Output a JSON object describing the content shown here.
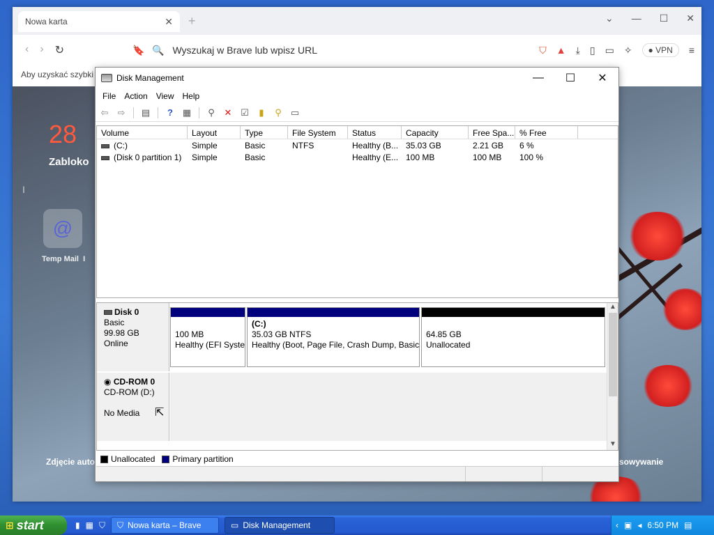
{
  "browser": {
    "tab_title": "Nowa karta",
    "tab_close": "✕",
    "new_tab": "+",
    "omnibox_placeholder": "Wyszukaj w Brave lub wpisz URL",
    "vpn_label": "VPN",
    "infobar_text": "Aby uzyskać szybki d",
    "newtab_page": {
      "date_number": "28",
      "status_text": "Zabloko",
      "tile_label": "Temp Mail",
      "tile_label_suffix": "I",
      "photo_text": "Zdjęcie auto",
      "sync_text": "sowywanie",
      "left_mark": "I"
    }
  },
  "disk_management": {
    "title": "Disk Management",
    "menu": [
      "File",
      "Action",
      "View",
      "Help"
    ],
    "volume_headers": [
      "Volume",
      "Layout",
      "Type",
      "File System",
      "Status",
      "Capacity",
      "Free Spa...",
      "% Free"
    ],
    "volumes": [
      {
        "volume": "(C:)",
        "layout": "Simple",
        "type": "Basic",
        "fs": "NTFS",
        "status": "Healthy (B...",
        "capacity": "35.03 GB",
        "free": "2.21 GB",
        "pct": "6 %"
      },
      {
        "volume": "(Disk 0 partition 1)",
        "layout": "Simple",
        "type": "Basic",
        "fs": "",
        "status": "Healthy (E...",
        "capacity": "100 MB",
        "free": "100 MB",
        "pct": "100 %"
      }
    ],
    "disk0": {
      "name": "Disk 0",
      "type": "Basic",
      "size": "99.98 GB",
      "state": "Online",
      "partitions": [
        {
          "size": "100 MB",
          "status": "Healthy (EFI Syste",
          "color": "#00007f"
        },
        {
          "label": "(C:)",
          "size": "35.03 GB NTFS",
          "status": "Healthy (Boot, Page File, Crash Dump, Basic",
          "color": "#00007f"
        },
        {
          "size": "64.85 GB",
          "status": "Unallocated",
          "color": "#000000"
        }
      ]
    },
    "cdrom": {
      "name": "CD-ROM 0",
      "drive": "CD-ROM (D:)",
      "media": "No Media"
    },
    "legend": [
      {
        "label": "Unallocated",
        "color": "#000000"
      },
      {
        "label": "Primary partition",
        "color": "#00007f"
      }
    ]
  },
  "taskbar": {
    "start_label": "start",
    "tasks": [
      "Nowa karta – Brave",
      "Disk Management"
    ],
    "clock": "6:50 PM"
  }
}
